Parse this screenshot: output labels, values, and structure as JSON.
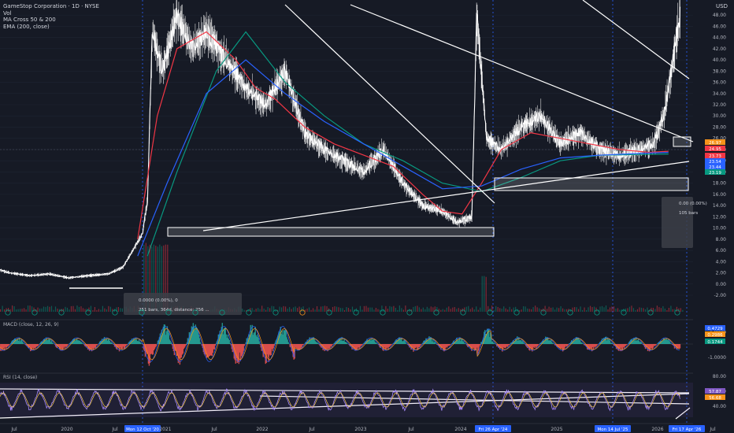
{
  "header": {
    "symbol_line": "GameStop Corporation · 1D · NYSE",
    "vol_line": "Vol",
    "ma_line": "MA Cross 50 & 200",
    "ema_line": "EMA (200, close)"
  },
  "currency": "USD",
  "panes": {
    "macd_label": "MACD (close, 12, 26, 9)",
    "rsi_label": "RSI (14, close)"
  },
  "price_tags": [
    {
      "text": "26.97",
      "color": "#f7931a"
    },
    {
      "text": "24.95",
      "color": "#f23645"
    },
    {
      "text": "23.73",
      "color": "#f23645"
    },
    {
      "text": "23.54",
      "color": "#2962ff"
    },
    {
      "text": "23.44",
      "color": "#2962ff"
    },
    {
      "text": "23.19",
      "color": "#089981"
    }
  ],
  "macd_tags": [
    {
      "text": "0.4729",
      "color": "#2962ff"
    },
    {
      "text": "0.2986",
      "color": "#f7931a"
    },
    {
      "text": "0.1744",
      "color": "#089981"
    }
  ],
  "rsi_tags": [
    {
      "text": "57.87",
      "color": "#7e57c2"
    },
    {
      "text": "56.68",
      "color": "#f7931a"
    }
  ],
  "measure_boxes": [
    {
      "line1": "0.0000 (0.00%), 0",
      "line2": "251 bars, 364d, distance: 256 ..."
    },
    {
      "line1": "0.00 (0.00%)",
      "line2": "105 bars"
    }
  ],
  "date_badges": [
    "Mon 12 Oct '20",
    "Fri 26 Apr '24",
    "Mon 14 Jul '25",
    "Fri 17 Apr '26"
  ],
  "chart_data": {
    "type": "line",
    "title": "GameStop Corporation · 1D · NYSE",
    "x_tick_labels": [
      "Jul",
      "2020",
      "Jul",
      "Mon 12 Oct '20",
      "2021",
      "Jul",
      "2022",
      "Jul",
      "2023",
      "Jul",
      "2024",
      "Fri 26 Apr '24",
      "2025",
      "Mon 14 Jul '25",
      "2026",
      "Fri 17 Apr '26",
      "Jul"
    ],
    "y_ticks": [
      48,
      46,
      44,
      42,
      40,
      38,
      36,
      34,
      32,
      30,
      28,
      26,
      24,
      22,
      20,
      18,
      16,
      14,
      12,
      10,
      8,
      6,
      4,
      2,
      0,
      -2
    ],
    "ylim": [
      -2,
      49
    ],
    "macd_ticks": [
      1.0,
      0,
      -1.0
    ],
    "rsi_ticks": [
      80,
      60,
      40
    ],
    "series": [
      {
        "name": "Price",
        "x": [
          2019.5,
          2019.6,
          2019.8,
          2020.0,
          2020.2,
          2020.4,
          2020.6,
          2020.75,
          2020.85,
          2020.95,
          2021.0,
          2021.05,
          2021.15,
          2021.3,
          2021.45,
          2021.6,
          2021.8,
          2022.0,
          2022.2,
          2022.4,
          2022.6,
          2022.8,
          2023.0,
          2023.2,
          2023.4,
          2023.6,
          2023.8,
          2024.0,
          2024.15,
          2024.3,
          2024.35,
          2024.45,
          2024.6,
          2024.8,
          2025.0,
          2025.2,
          2025.4,
          2025.6,
          2025.8,
          2026.0,
          2026.15,
          2026.25,
          2026.32,
          2026.38,
          2026.42
        ],
        "y": [
          2.5,
          2.0,
          1.5,
          1.8,
          1.1,
          1.5,
          1.8,
          3.0,
          6.0,
          9.0,
          15.0,
          45.0,
          38.0,
          48.0,
          42.0,
          45.0,
          40.0,
          35.0,
          32.0,
          38.0,
          27.0,
          24.0,
          22.0,
          20.0,
          24.0,
          18.0,
          14.0,
          13.0,
          11.0,
          12.0,
          48.0,
          26.0,
          24.0,
          28.0,
          30.0,
          25.0,
          27.0,
          24.0,
          23.0,
          24.0,
          25.0,
          30.0,
          37.0,
          44.0,
          48.0
        ]
      },
      {
        "name": "MA Cross 50 & 200 (fast)",
        "x": [
          2020.9,
          2021.1,
          2021.3,
          2021.6,
          2021.9,
          2022.1,
          2022.3,
          2022.6,
          2022.9,
          2023.2,
          2023.5,
          2023.8,
          2024.0,
          2024.2,
          2024.4,
          2024.6,
          2024.9,
          2025.2,
          2025.5,
          2025.8,
          2026.1,
          2026.3
        ],
        "y": [
          8.0,
          30.0,
          42.0,
          45.0,
          40.0,
          35.0,
          33.0,
          28.0,
          25.0,
          23.0,
          21.0,
          16.0,
          13.0,
          12.5,
          18.0,
          24.0,
          27.0,
          26.0,
          25.0,
          24.0,
          23.5,
          23.7
        ]
      },
      {
        "name": "MA Cross 50 & 200 (slow)",
        "x": [
          2021.0,
          2021.3,
          2021.7,
          2022.0,
          2022.4,
          2022.8,
          2023.2,
          2023.6,
          2024.0,
          2024.4,
          2024.8,
          2025.2,
          2025.6,
          2026.0,
          2026.3
        ],
        "y": [
          5.0,
          20.0,
          38.0,
          45.0,
          36.0,
          30.0,
          25.0,
          22.0,
          18.0,
          16.5,
          19.0,
          22.0,
          23.0,
          23.1,
          23.2
        ]
      },
      {
        "name": "EMA (200, close)",
        "x": [
          2020.9,
          2021.2,
          2021.6,
          2022.0,
          2022.4,
          2022.8,
          2023.2,
          2023.6,
          2024.0,
          2024.4,
          2024.8,
          2025.2,
          2025.6,
          2026.0,
          2026.3
        ],
        "y": [
          5.0,
          18.0,
          34.0,
          40.0,
          34.0,
          29.0,
          25.0,
          21.0,
          17.0,
          17.5,
          20.5,
          22.5,
          23.0,
          23.3,
          23.5
        ]
      }
    ]
  }
}
